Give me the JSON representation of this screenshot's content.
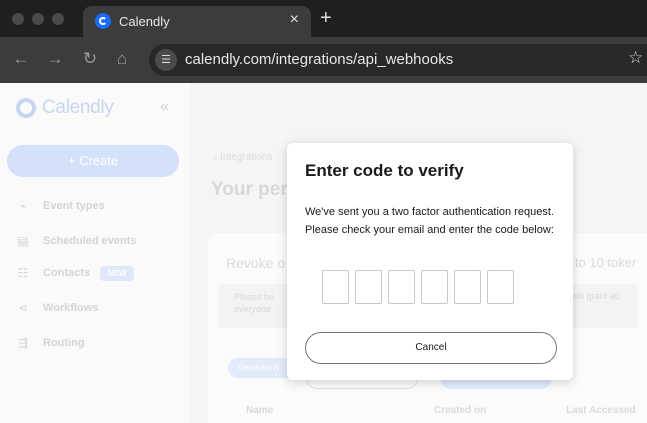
{
  "browser": {
    "tab_title": "Calendly",
    "url": "calendly.com/integrations/api_webhooks",
    "close_glyph": "×",
    "newtab_glyph": "+"
  },
  "sidebar": {
    "logo_text": "Calendly",
    "collapse_glyph": "«",
    "create_label": "+ Create",
    "items": [
      {
        "label": "Event types",
        "icon": "⌁"
      },
      {
        "label": "Scheduled events",
        "icon": "▤"
      },
      {
        "label": "Contacts",
        "icon": "☷",
        "badge": "NEW"
      },
      {
        "label": "Workflows",
        "icon": "⋖"
      },
      {
        "label": "Routing",
        "icon": "⇶"
      }
    ]
  },
  "main": {
    "breadcrumb": "‹ Integrations",
    "title": "Your per",
    "card": {
      "revoke": "Revoke o",
      "limit": "p to 10 toker",
      "note_left": "Please be\neveryone",
      "note_right": "in will grant ac",
      "generate": "Generate N",
      "col_name": "Name",
      "col_created": "Created on",
      "col_last": "Last Accessed"
    }
  },
  "modal": {
    "title": "Enter code to verify",
    "body": "We've sent you a two factor authentication request. Please check your email and enter the code below:",
    "code_length": 6,
    "cancel_label": "Cancel"
  }
}
